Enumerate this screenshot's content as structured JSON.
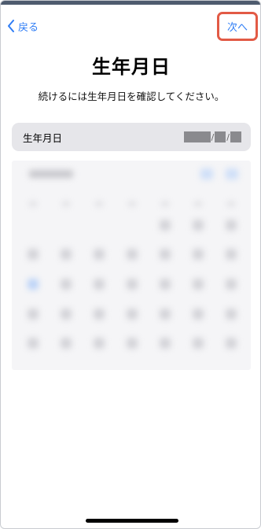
{
  "nav": {
    "back_label": "戻る",
    "next_label": "次へ"
  },
  "page": {
    "title": "生年月日",
    "subtitle": "続けるには生年月日を確認してください。"
  },
  "dob_field": {
    "label": "生年月日",
    "value_masked": true
  },
  "calendar": {
    "obscured": true
  },
  "colors": {
    "accent": "#2f7df5",
    "highlight_border": "#e25a45",
    "field_background": "#e6e6ea"
  }
}
